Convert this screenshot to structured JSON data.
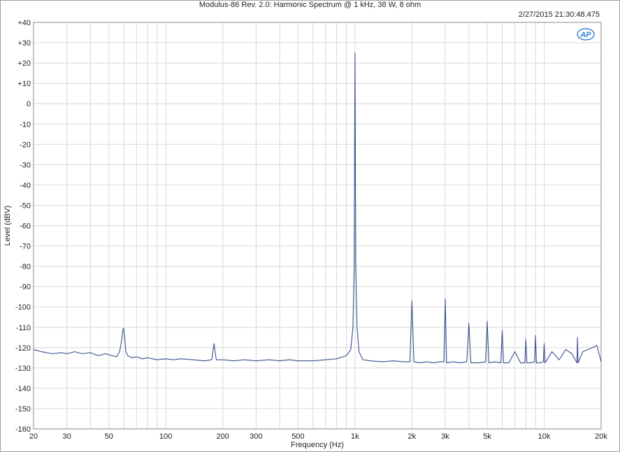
{
  "header": {
    "title": "Modulus-86 Rev. 2.0: Harmonic Spectrum @ 1 kHz, 38 W, 8 ohm",
    "timestamp": "2/27/2015 21:30:48.475",
    "logo_text": "AP"
  },
  "colors": {
    "trace": "#3a4f8f",
    "grid": "#d8d8d8",
    "axis": "#8a8a8a",
    "logo": "#2f7fd6"
  },
  "chart_data": {
    "type": "line",
    "title": "Modulus-86 Rev. 2.0: Harmonic Spectrum @ 1 kHz, 38 W, 8 ohm",
    "xlabel": "Frequency (Hz)",
    "ylabel": "Level (dBV)",
    "xscale": "log",
    "xlim": [
      20,
      20000
    ],
    "ylim": [
      -160,
      40
    ],
    "grid": true,
    "x_ticks": [
      {
        "value": 20,
        "label": "20"
      },
      {
        "value": 30,
        "label": "30"
      },
      {
        "value": 50,
        "label": "50"
      },
      {
        "value": 100,
        "label": "100"
      },
      {
        "value": 200,
        "label": "200"
      },
      {
        "value": 300,
        "label": "300"
      },
      {
        "value": 500,
        "label": "500"
      },
      {
        "value": 1000,
        "label": "1k"
      },
      {
        "value": 2000,
        "label": "2k"
      },
      {
        "value": 3000,
        "label": "3k"
      },
      {
        "value": 5000,
        "label": "5k"
      },
      {
        "value": 10000,
        "label": "10k"
      },
      {
        "value": 20000,
        "label": "20k"
      }
    ],
    "y_ticks": [
      {
        "value": 40,
        "label": "+40"
      },
      {
        "value": 30,
        "label": "+30"
      },
      {
        "value": 20,
        "label": "+20"
      },
      {
        "value": 10,
        "label": "+10"
      },
      {
        "value": 0,
        "label": "0"
      },
      {
        "value": -10,
        "label": "-10"
      },
      {
        "value": -20,
        "label": "-20"
      },
      {
        "value": -30,
        "label": "-30"
      },
      {
        "value": -40,
        "label": "-40"
      },
      {
        "value": -50,
        "label": "-50"
      },
      {
        "value": -60,
        "label": "-60"
      },
      {
        "value": -70,
        "label": "-70"
      },
      {
        "value": -80,
        "label": "-80"
      },
      {
        "value": -90,
        "label": "-90"
      },
      {
        "value": -100,
        "label": "-100"
      },
      {
        "value": -110,
        "label": "-110"
      },
      {
        "value": -120,
        "label": "-120"
      },
      {
        "value": -130,
        "label": "-130"
      },
      {
        "value": -140,
        "label": "-140"
      },
      {
        "value": -150,
        "label": "-150"
      },
      {
        "value": -160,
        "label": "-160"
      }
    ],
    "series": [
      {
        "x": [
          20,
          22,
          25,
          28,
          30,
          33,
          36,
          40,
          44,
          48,
          52,
          55,
          57,
          58.5,
          59.3,
          60,
          60.7,
          61.5,
          63,
          66,
          70,
          75,
          80,
          90,
          100,
          110,
          120,
          140,
          160,
          175,
          178,
          180,
          182,
          185,
          200,
          230,
          260,
          300,
          350,
          400,
          450,
          500,
          600,
          700,
          800,
          900,
          950,
          975,
          990,
          1000,
          1010,
          1025,
          1050,
          1100,
          1200,
          1400,
          1600,
          1800,
          1950,
          2000,
          2050,
          2200,
          2400,
          2600,
          2800,
          2950,
          3000,
          3050,
          3300,
          3600,
          3900,
          4000,
          4100,
          4500,
          4900,
          5000,
          5100,
          5500,
          5900,
          6000,
          6100,
          6500,
          7000,
          7500,
          7900,
          8000,
          8100,
          8500,
          8900,
          9000,
          9100,
          9500,
          9900,
          10000,
          10100,
          11000,
          12000,
          13000,
          14000,
          14900,
          15000,
          15100,
          16000,
          17000,
          18000,
          19000,
          20000
        ],
        "y": [
          -121,
          -122,
          -123,
          -122.5,
          -123,
          -122,
          -123,
          -122.5,
          -124,
          -123,
          -124,
          -124.5,
          -122,
          -116,
          -111,
          -110.5,
          -115,
          -122,
          -124,
          -125,
          -124.5,
          -125.5,
          -125,
          -126,
          -125.5,
          -126,
          -125.5,
          -126,
          -126.5,
          -126,
          -121,
          -118,
          -122,
          -126,
          -126,
          -126.5,
          -126,
          -126.5,
          -126,
          -126.5,
          -126,
          -126.5,
          -126.5,
          -126,
          -125.5,
          -124,
          -121,
          -110,
          -80,
          25,
          -80,
          -110,
          -122,
          -126,
          -126.5,
          -127,
          -126.5,
          -127,
          -127,
          -97,
          -127,
          -127.5,
          -127,
          -127.5,
          -127,
          -127,
          -96,
          -127.5,
          -127,
          -127.5,
          -127,
          -108,
          -127.5,
          -127.5,
          -127,
          -107,
          -127.5,
          -127,
          -127.5,
          -111.5,
          -127.5,
          -127.5,
          -122,
          -127.5,
          -127.5,
          -116,
          -127.5,
          -127.5,
          -127,
          -114,
          -127.5,
          -127.5,
          -127,
          -118,
          -127.5,
          -122,
          -126,
          -121,
          -123,
          -127.5,
          -115,
          -127.5,
          -122,
          -121,
          -120,
          -119,
          -127
        ]
      }
    ]
  }
}
